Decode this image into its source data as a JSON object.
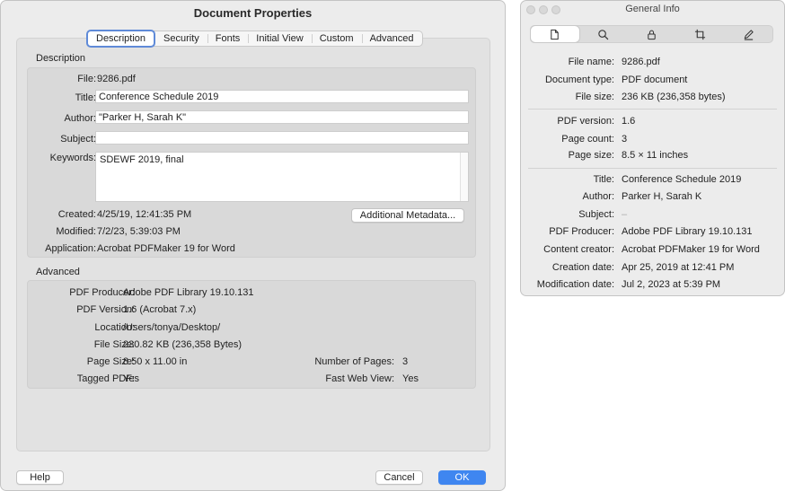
{
  "doc_props": {
    "title": "Document Properties",
    "tabs": [
      "Description",
      "Security",
      "Fonts",
      "Initial View",
      "Custom",
      "Advanced"
    ],
    "description": {
      "section_label": "Description",
      "file_label": "File:",
      "file_value": "9286.pdf",
      "title_label": "Title:",
      "title_value": "Conference Schedule 2019",
      "author_label": "Author:",
      "author_value": "\"Parker H, Sarah K\"",
      "subject_label": "Subject:",
      "subject_value": "",
      "keywords_label": "Keywords:",
      "keywords_value": "SDEWF 2019, final",
      "created_label": "Created:",
      "created_value": "4/25/19, 12:41:35 PM",
      "modified_label": "Modified:",
      "modified_value": "7/2/23, 5:39:03 PM",
      "application_label": "Application:",
      "application_value": "Acrobat PDFMaker 19 for Word",
      "metadata_button": "Additional Metadata..."
    },
    "advanced": {
      "section_label": "Advanced",
      "producer_label": "PDF Producer:",
      "producer_value": "Adobe PDF Library 19.10.131",
      "version_label": "PDF Version:",
      "version_value": "1.6 (Acrobat 7.x)",
      "location_label": "Location:",
      "location_value": "/Users/tonya/Desktop/",
      "filesize_label": "File Size:",
      "filesize_value": "230.82 KB (236,358 Bytes)",
      "pagesize_label": "Page Size:",
      "pagesize_value": "8.50 x 11.00 in",
      "pages_label": "Number of Pages:",
      "pages_value": "3",
      "tagged_label": "Tagged PDF:",
      "tagged_value": "Yes",
      "fastweb_label": "Fast Web View:",
      "fastweb_value": "Yes"
    },
    "buttons": {
      "help": "Help",
      "cancel": "Cancel",
      "ok": "OK"
    }
  },
  "general_info": {
    "title": "General Info",
    "tab_icons": [
      "document-icon",
      "search-icon",
      "lock-icon",
      "crop-icon",
      "pencil-icon"
    ],
    "rows": {
      "file_name_label": "File name:",
      "file_name_value": "9286.pdf",
      "doc_type_label": "Document type:",
      "doc_type_value": "PDF document",
      "file_size_label": "File size:",
      "file_size_value": "236 KB (236,358 bytes)",
      "pdf_version_label": "PDF version:",
      "pdf_version_value": "1.6",
      "page_count_label": "Page count:",
      "page_count_value": "3",
      "page_size_label": "Page size:",
      "page_size_value": "8.5 × 11 inches",
      "title_label": "Title:",
      "title_value": "Conference Schedule 2019",
      "author_label": "Author:",
      "author_value": "Parker H, Sarah K",
      "subject_label": "Subject:",
      "subject_value": "–",
      "producer_label": "PDF Producer:",
      "producer_value": "Adobe PDF Library 19.10.131",
      "creator_label": "Content creator:",
      "creator_value": "Acrobat PDFMaker 19 for Word",
      "creation_label": "Creation date:",
      "creation_value": "Apr 25, 2019 at 12:41 PM",
      "modification_label": "Modification date:",
      "modification_value": "Jul 2, 2023 at 5:39 PM"
    }
  },
  "colors": {
    "accent": "#3f86f0",
    "focus_ring": "#5f8ad8",
    "window_bg": "#ececec"
  }
}
